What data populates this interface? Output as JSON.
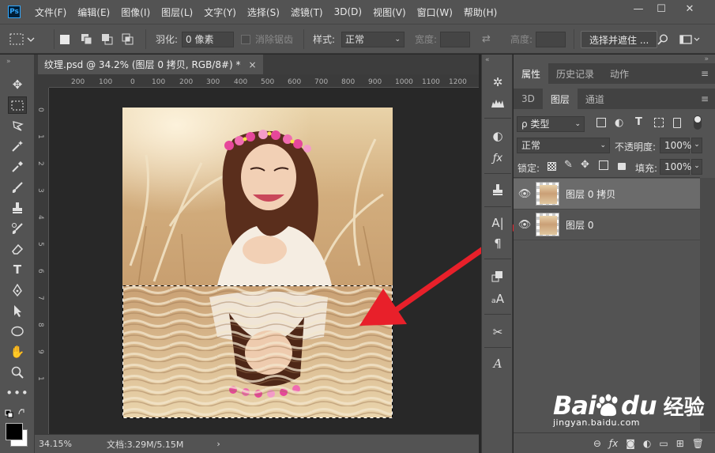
{
  "app": {
    "logo": "Ps"
  },
  "menu": [
    "文件(F)",
    "编辑(E)",
    "图像(I)",
    "图层(L)",
    "文字(Y)",
    "选择(S)",
    "滤镜(T)",
    "3D(D)",
    "视图(V)",
    "窗口(W)",
    "帮助(H)"
  ],
  "options": {
    "feather_label": "羽化:",
    "feather_value": "0 像素",
    "antialias_label": "消除锯齿",
    "style_label": "样式:",
    "style_value": "正常",
    "width_label": "宽度:",
    "height_label": "高度:",
    "select_mask_button": "选择并遮住 ..."
  },
  "document": {
    "tab_title": "纹理.psd @ 34.2% (图层 0 拷贝, RGB/8#) *",
    "close": "×"
  },
  "ruler": {
    "h_ticks": [
      "200",
      "100",
      "0",
      "100",
      "200",
      "300",
      "400",
      "500",
      "600",
      "700",
      "800",
      "900",
      "1000",
      "1100",
      "1200"
    ],
    "v_ticks": [
      "0",
      "1",
      "2",
      "3",
      "4",
      "5",
      "6",
      "7",
      "8",
      "9",
      "1"
    ]
  },
  "status": {
    "zoom": "34.15%",
    "doc_info": "文档:3.29M/5.15M",
    "arrow": "›"
  },
  "panel": {
    "top_tabs": [
      "属性",
      "历史记录",
      "动作"
    ],
    "layer_tabs": [
      "3D",
      "图层",
      "通道"
    ],
    "filter_kind": "ρ 类型",
    "blend_mode": "正常",
    "opacity_label": "不透明度:",
    "opacity_value": "100%",
    "lock_label": "锁定:",
    "fill_label": "填充:",
    "fill_value": "100%",
    "layers": [
      {
        "name": "图层 0 拷贝",
        "selected": true
      },
      {
        "name": "图层 0",
        "selected": false
      }
    ]
  },
  "watermark": {
    "brand": "Bai",
    "brand2": "du",
    "product": "经验",
    "url": "jingyan.baidu.com"
  },
  "colors": {
    "accent_arrow": "#e8202a",
    "ps_blue": "#31a8ff",
    "panel_bg": "#535353",
    "canvas_bg": "#282828"
  }
}
